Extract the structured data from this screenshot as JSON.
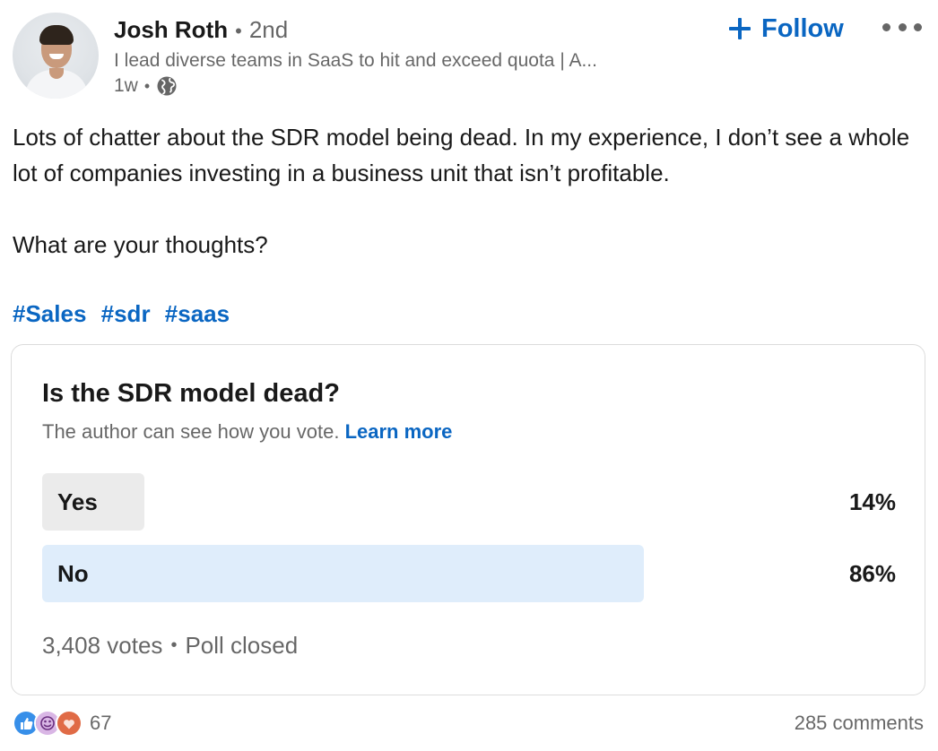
{
  "author": {
    "name": "Josh Roth",
    "degree": "2nd",
    "headline": "I lead diverse teams in SaaS to hit and exceed quota | A...",
    "time": "1w",
    "visibility_icon": "globe-icon"
  },
  "actions": {
    "follow_label": "Follow",
    "follow_icon": "plus-icon",
    "more_icon": "ellipsis-icon"
  },
  "post": {
    "paragraphs": [
      "Lots of chatter about the SDR model being dead. In my experience, I don’t see a whole lot of companies investing in a business unit that isn’t profitable.",
      "What are your thoughts?"
    ],
    "hashtags": [
      "#Sales",
      "#sdr",
      "#saas"
    ]
  },
  "poll": {
    "question": "Is the SDR model dead?",
    "note": "The author can see how you vote.",
    "learn_more": "Learn more",
    "options": [
      {
        "label": "Yes",
        "percent": "14%",
        "fraction": 0.14,
        "selected": false
      },
      {
        "label": "No",
        "percent": "86%",
        "fraction": 0.86,
        "selected": true
      }
    ],
    "votes": "3,408 votes",
    "status": "Poll closed"
  },
  "social": {
    "reactions": [
      "like-icon",
      "insightful-icon",
      "love-icon"
    ],
    "reaction_count": "67",
    "comments": "285 comments"
  },
  "colors": {
    "accent": "#0a66c2",
    "option_bar": "#ebebeb",
    "option_bar_winner": "#dfedfb",
    "like": "#378fe9",
    "insightful": "#d9b6e5",
    "love": "#e06b46"
  }
}
